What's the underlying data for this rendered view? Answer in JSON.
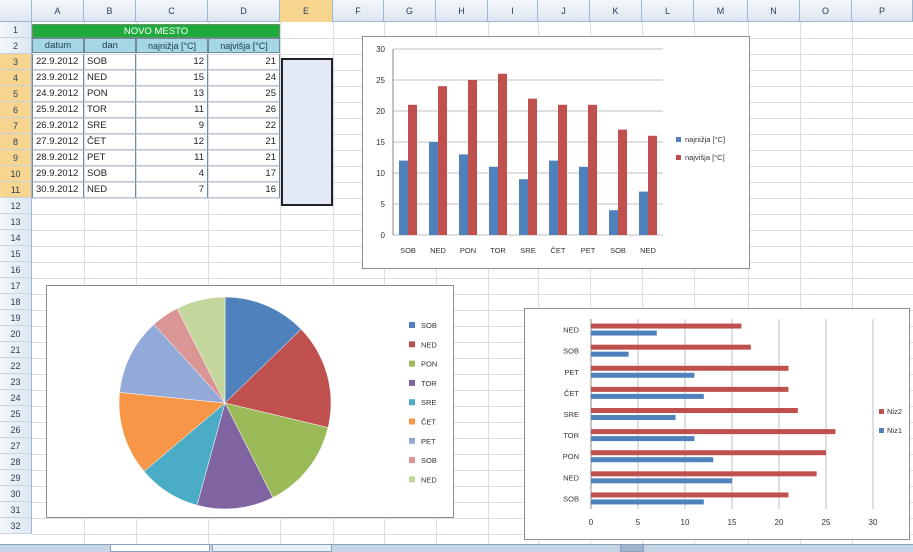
{
  "columns": [
    "A",
    "B",
    "C",
    "D",
    "E",
    "F",
    "G",
    "H",
    "I",
    "J",
    "K",
    "L",
    "M",
    "N",
    "O",
    "P"
  ],
  "selected_column": "E",
  "rows": [
    "1",
    "2",
    "3",
    "4",
    "5",
    "6",
    "7",
    "8",
    "9",
    "10",
    "11",
    "12",
    "13",
    "14",
    "15",
    "16",
    "17",
    "18",
    "19",
    "20",
    "21",
    "22",
    "23",
    "24",
    "25",
    "26",
    "27",
    "28",
    "29",
    "30",
    "31",
    "32"
  ],
  "selected_rows": [
    "3",
    "4",
    "5",
    "6",
    "7",
    "8",
    "9",
    "10",
    "11"
  ],
  "table": {
    "title": "NOVO MESTO",
    "headers": [
      "datum",
      "dan",
      "najnižja [°C]",
      "najvišja [°C]"
    ],
    "rows": [
      [
        "22.9.2012",
        "SOB",
        "12",
        "21"
      ],
      [
        "23.9.2012",
        "NED",
        "15",
        "24"
      ],
      [
        "24.9.2012",
        "PON",
        "13",
        "25"
      ],
      [
        "25.9.2012",
        "TOR",
        "11",
        "26"
      ],
      [
        "26.9.2012",
        "SRE",
        "9",
        "22"
      ],
      [
        "27.9.2012",
        "ČET",
        "12",
        "21"
      ],
      [
        "28.9.2012",
        "PET",
        "11",
        "21"
      ],
      [
        "29.9.2012",
        "SOB",
        "4",
        "17"
      ],
      [
        "30.9.2012",
        "NED",
        "7",
        "16"
      ]
    ]
  },
  "colors": {
    "title_bg": "#1fab3c",
    "header_bg": "#a6d7e6",
    "series_low": "#4f81bd",
    "series_high": "#c0504d",
    "selection": "#e4e9f7"
  },
  "chart_data": [
    {
      "type": "bar",
      "categories": [
        "SOB",
        "NED",
        "PON",
        "TOR",
        "SRE",
        "ČET",
        "PET",
        "SOB",
        "NED"
      ],
      "series": [
        {
          "name": "najnižja [°C]",
          "values": [
            12,
            15,
            13,
            11,
            9,
            12,
            11,
            4,
            7
          ],
          "color": "#4f81bd"
        },
        {
          "name": "najvišja [°C]",
          "values": [
            21,
            24,
            25,
            26,
            22,
            21,
            21,
            17,
            16
          ],
          "color": "#c0504d"
        }
      ],
      "yticks": [
        "0",
        "5",
        "10",
        "15",
        "20",
        "25",
        "30"
      ],
      "ylim": [
        0,
        30
      ],
      "grid": true,
      "legend": "right"
    },
    {
      "type": "pie",
      "labels": [
        "SOB",
        "NED",
        "PON",
        "TOR",
        "SRE",
        "ČET",
        "PET",
        "SOB",
        "NED"
      ],
      "values": [
        12,
        15,
        13,
        11,
        9,
        12,
        11,
        4,
        7
      ],
      "colors": [
        "#4f81bd",
        "#c0504d",
        "#9bbb59",
        "#8064a2",
        "#4bacc6",
        "#f79646",
        "#93a9d8",
        "#d99694",
        "#c3d69b"
      ],
      "legend": "right"
    },
    {
      "type": "bar",
      "orientation": "horizontal",
      "categories": [
        "SOB",
        "NED",
        "PON",
        "TOR",
        "SRE",
        "ČET",
        "PET",
        "SOB",
        "NED"
      ],
      "series": [
        {
          "name": "Niz1",
          "values": [
            12,
            15,
            13,
            11,
            9,
            12,
            11,
            4,
            7
          ],
          "color": "#4f81bd"
        },
        {
          "name": "Niz2",
          "values": [
            21,
            24,
            25,
            26,
            22,
            21,
            21,
            17,
            16
          ],
          "color": "#c0504d"
        }
      ],
      "xticks": [
        "0",
        "5",
        "10",
        "15",
        "20",
        "25",
        "30"
      ],
      "xlim": [
        0,
        30
      ],
      "grid": true,
      "legend": "right"
    }
  ]
}
